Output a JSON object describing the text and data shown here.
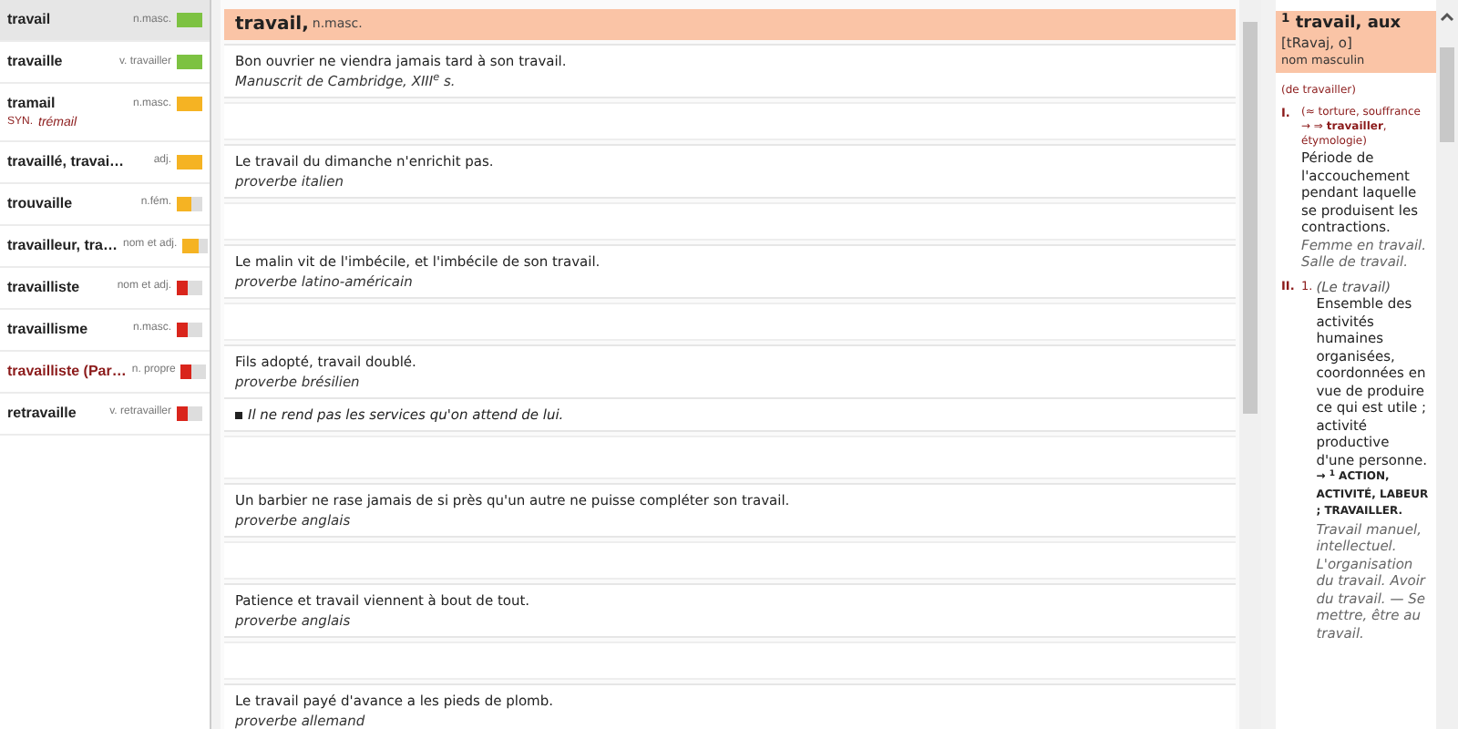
{
  "word_list": [
    {
      "word": "travail",
      "pos": "n.masc.",
      "level": 1,
      "color": "#7dc242",
      "selected": true,
      "kind": "common"
    },
    {
      "word": "travaille",
      "pos": "v. travailler",
      "level": 1,
      "color": "#7dc242",
      "selected": false,
      "kind": "common"
    },
    {
      "word": "tramail",
      "pos": "n.masc.",
      "synonym_label": "SYN.",
      "synonym": "trémail",
      "level": 1,
      "color": "#f5b323",
      "selected": false,
      "kind": "common"
    },
    {
      "word": "travaillé, travai…",
      "pos": "adj.",
      "level": 1,
      "color": "#f5b323",
      "selected": false,
      "kind": "common"
    },
    {
      "word": "trouvaille",
      "pos": "n.fém.",
      "level": 0.6,
      "color": "#f5b323",
      "selected": false,
      "kind": "common"
    },
    {
      "word": "travailleur, tra…",
      "pos": "nom et adj.",
      "level": 0.6,
      "color": "#f5b323",
      "selected": false,
      "kind": "common"
    },
    {
      "word": "travailliste",
      "pos": "nom et adj.",
      "level": 0.4,
      "color": "#d9251c",
      "selected": false,
      "kind": "common"
    },
    {
      "word": "travaillisme",
      "pos": "n.masc.",
      "level": 0.4,
      "color": "#d9251c",
      "selected": false,
      "kind": "common"
    },
    {
      "word": "travailliste (Par…",
      "pos": "n. propre",
      "level": 0.4,
      "color": "#d9251c",
      "selected": false,
      "kind": "proper"
    },
    {
      "word": "retravaille",
      "pos": "v. retravailler",
      "level": 0.4,
      "color": "#d9251c",
      "selected": false,
      "kind": "common"
    }
  ],
  "quotes_header": {
    "word": "travail,",
    "pos": "n.masc."
  },
  "quotes": [
    {
      "text": "Bon ouvrier ne viendra jamais tard à son travail.",
      "source": "Manuscrit de Cambridge, XIII$^{e}$ s."
    },
    {
      "text": "Le travail du dimanche n'enrichit pas.",
      "source": "proverbe italien"
    },
    {
      "text": "Le malin vit de l'imbécile, et l'imbécile de son travail.",
      "source": "proverbe latino-américain"
    },
    {
      "text": "Fils adopté, travail doublé.",
      "source": "proverbe brésilien",
      "note": "Il ne rend pas les services qu'on attend de lui."
    },
    {
      "text": "Un barbier ne rase jamais de si près qu'un autre ne puisse compléter son travail.",
      "source": "proverbe anglais"
    },
    {
      "text": "Patience et travail viennent à bout de tout.",
      "source": "proverbe anglais"
    },
    {
      "text": "Le travail payé d'avance a les pieds de plomb.",
      "source": "proverbe allemand"
    }
  ],
  "definition": {
    "headword": "$^{1}$ travail, aux",
    "pronunciation": "[tRavaj, o]",
    "category": "nom masculin",
    "etymology": "(de travailler)",
    "senses": [
      {
        "number": "I.",
        "gloss": "(≈ torture, souffrance → ⇒ **travailler**, étymologie)",
        "text": "Période de l'accouchement pendant laquelle se produisent les contractions.",
        "examples": "Femme en travail. Salle de travail."
      },
      {
        "number": "II.",
        "subnumber": "1.",
        "gloss": "(Le travail)",
        "text": "Ensemble des activités humaines organisées, coordonnées en vue de produire ce qui est utile ; activité productive d'une personne.",
        "crossref": "→ $^{1}$ ACTION, ACTIVITÉ, LABEUR ; TRAVAILLER.",
        "examples": "Travail manuel, intellectuel. L'organisation du travail. Avoir du travail. — Se mettre, être au travail."
      }
    ]
  }
}
